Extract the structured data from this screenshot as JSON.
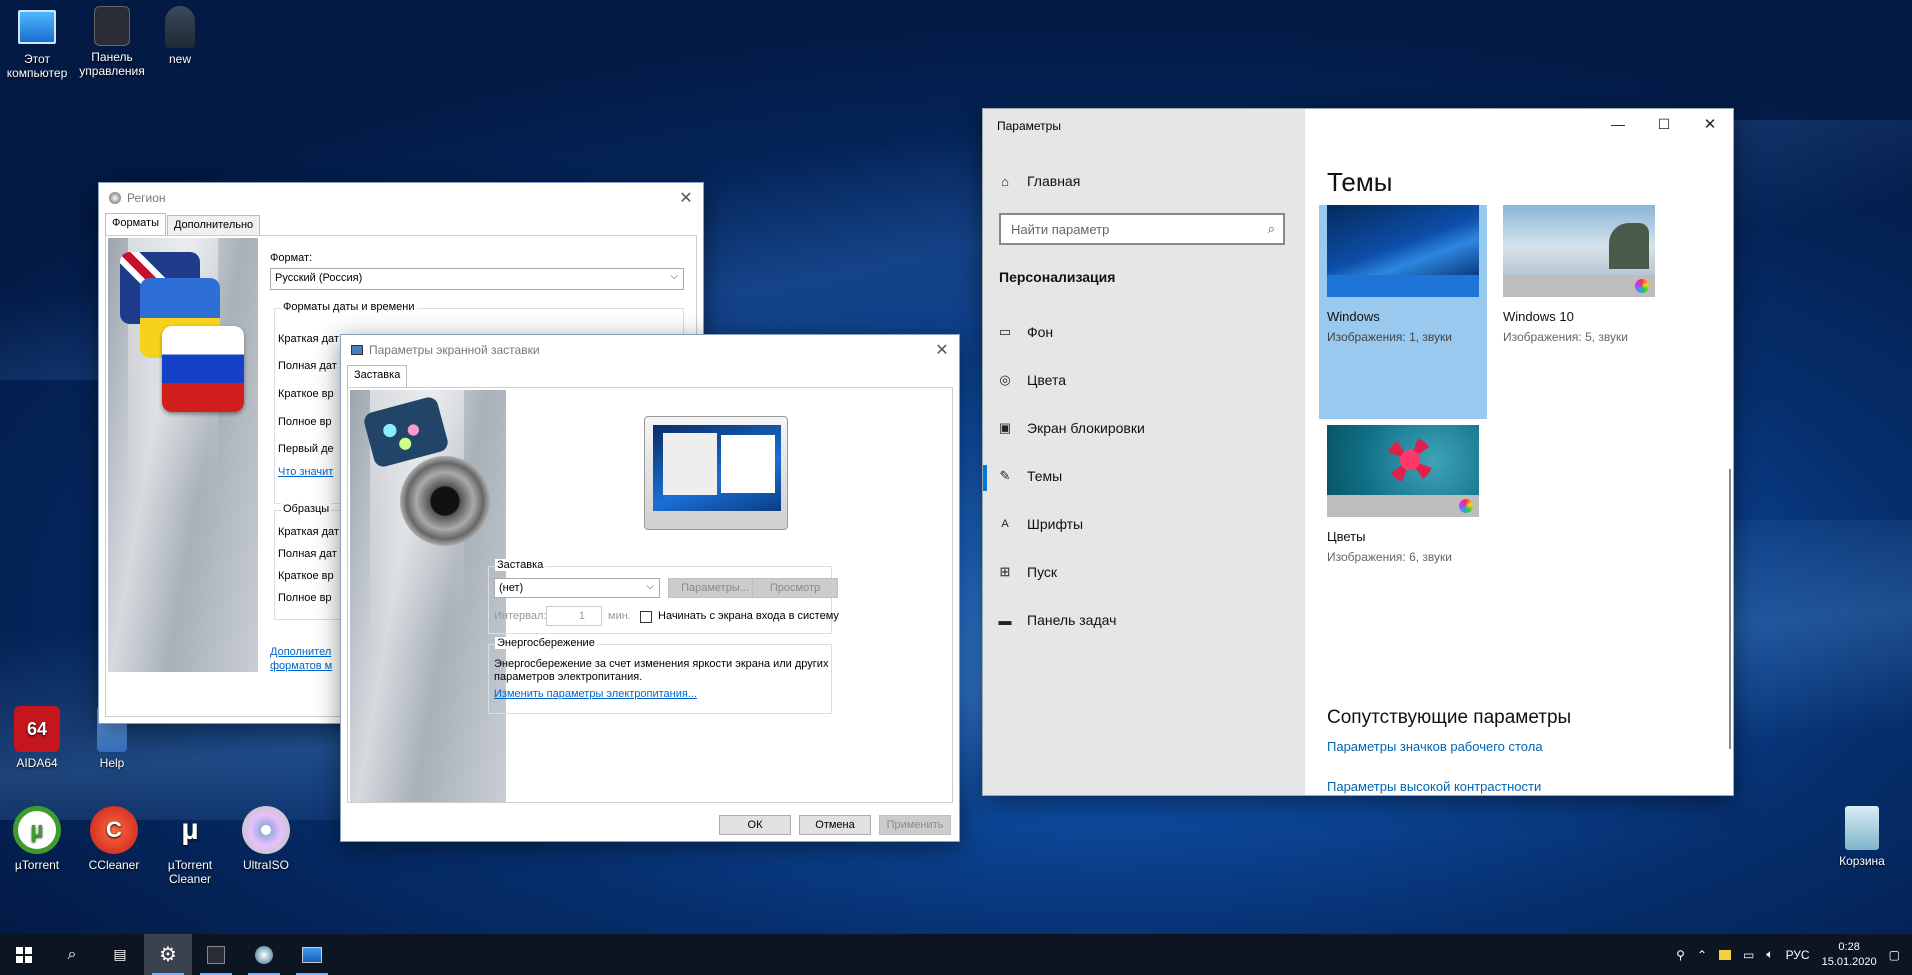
{
  "desktop": {
    "icons": [
      {
        "label": "Этот компьютер",
        "line1": "Этот",
        "line2": "компьютер",
        "icon": "monitor-icon"
      },
      {
        "label": "Панель управления",
        "line1": "Панель",
        "line2": "управления",
        "icon": "control-panel-icon"
      },
      {
        "label": "new",
        "line1": "new",
        "line2": "",
        "icon": "user-icon"
      },
      {
        "label": "AIDA64",
        "line1": "AIDA64",
        "line2": "",
        "icon": "aida64-icon"
      },
      {
        "label": "Help",
        "line1": "Help",
        "line2": "",
        "icon": "help-icon"
      },
      {
        "label": "µTorrent",
        "line1": "µTorrent",
        "line2": "",
        "icon": "utorrent-icon"
      },
      {
        "label": "CCleaner",
        "line1": "CCleaner",
        "line2": "",
        "icon": "ccleaner-icon"
      },
      {
        "label": "µTorrent Cleaner",
        "line1": "µTorrent",
        "line2": "Cleaner",
        "icon": "utorrent-cleaner-icon"
      },
      {
        "label": "UltraISO",
        "line1": "UltraISO",
        "line2": "",
        "icon": "ultraiso-icon"
      },
      {
        "label": "Корзина",
        "line1": "Корзина",
        "line2": "",
        "icon": "recycle-bin-icon"
      }
    ]
  },
  "region": {
    "title": "Регион",
    "tabs": [
      "Форматы",
      "Дополнительно"
    ],
    "format_label": "Формат:",
    "format_value": "Русский (Россия)",
    "dates_group": "Форматы даты и времени",
    "rows": [
      "Краткая дат",
      "Полная дат",
      "Краткое вр",
      "Полное вр",
      "Первый де"
    ],
    "what_link": "Что значит",
    "samples_group": "Образцы",
    "sample_rows": [
      "Краткая дат",
      "Полная дат",
      "Краткое вр",
      "Полное вр"
    ],
    "extra_link1": "Дополнител",
    "extra_link2": "форматов м"
  },
  "screensaver": {
    "title": "Параметры экранной заставки",
    "tab": "Заставка",
    "group_saver": "Заставка",
    "saver_value": "(нет)",
    "params_button": "Параметры...",
    "preview_button": "Просмотр",
    "interval_label": "Интервал:",
    "interval_value": "1",
    "interval_unit": "мин.",
    "login_checkbox": "Начинать с экрана входа в систему",
    "group_power": "Энергосбережение",
    "power_text1": "Энергосбережение за счет изменения яркости экрана или других",
    "power_text2": "параметров электропитания.",
    "power_link": "Изменить параметры электропитания...",
    "ok": "ОК",
    "cancel": "Отмена",
    "apply": "Применить"
  },
  "settings": {
    "title": "Параметры",
    "home": "Главная",
    "search_placeholder": "Найти параметр",
    "section": "Персонализация",
    "nav": [
      {
        "label": "Фон",
        "icon": "image-icon"
      },
      {
        "label": "Цвета",
        "icon": "palette-icon"
      },
      {
        "label": "Экран блокировки",
        "icon": "lock-screen-icon"
      },
      {
        "label": "Темы",
        "icon": "brush-icon"
      },
      {
        "label": "Шрифты",
        "icon": "font-icon"
      },
      {
        "label": "Пуск",
        "icon": "start-icon"
      },
      {
        "label": "Панель задач",
        "icon": "taskbar-icon"
      }
    ],
    "page_title": "Темы",
    "themes": [
      {
        "name": "Windows",
        "sub": "Изображения: 1, звуки",
        "selected": true
      },
      {
        "name": "Windows 10",
        "sub": "Изображения: 5, звуки",
        "selected": false
      },
      {
        "name": "Цветы",
        "sub": "Изображения: 6, звуки",
        "selected": false
      }
    ],
    "related_title": "Сопутствующие параметры",
    "related_links": [
      "Параметры значков рабочего стола",
      "Параметры высокой контрастности"
    ],
    "accent_color": "#0078d7"
  },
  "taskbar": {
    "lang": "РУС",
    "time": "0:28",
    "date": "15.01.2020"
  }
}
